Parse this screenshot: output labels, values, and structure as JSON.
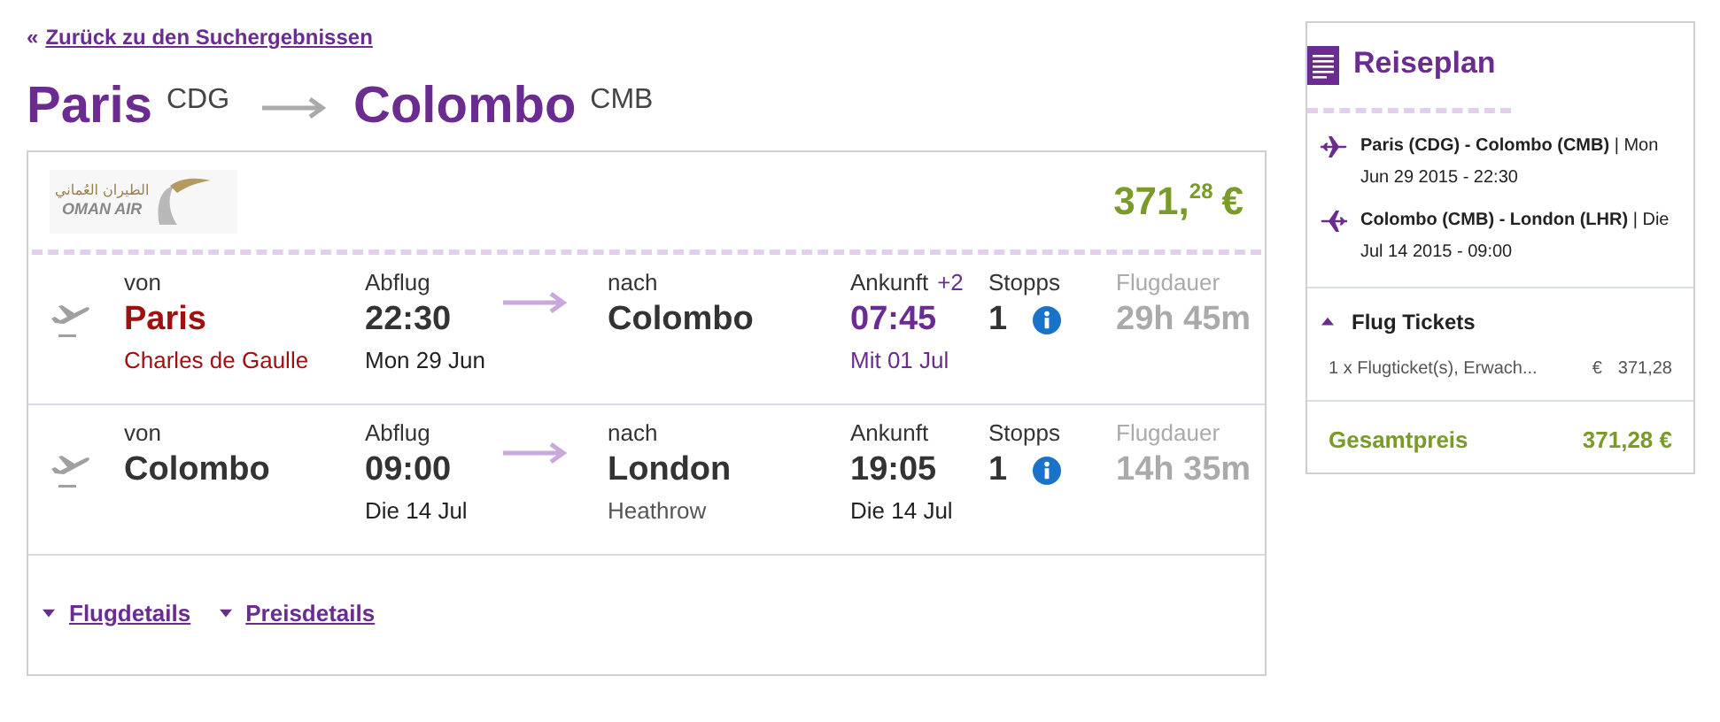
{
  "back_link": {
    "prefix": "«",
    "label": "Zurück zu den Suchergebnissen"
  },
  "route": {
    "from_city": "Paris",
    "from_code": "CDG",
    "to_city": "Colombo",
    "to_code": "CMB"
  },
  "offer": {
    "airline_logo": {
      "arabic": "الطيران العُماني",
      "latin": "OMAN AIR"
    },
    "price_main": "371,",
    "price_cents": "28",
    "currency": "€",
    "legs": [
      {
        "from_label": "von",
        "from_city": "Paris",
        "from_airport": "Charles de Gaulle",
        "from_highlighted": true,
        "dep_label": "Abflug",
        "dep_time": "22:30",
        "dep_date": "Mon 29 Jun",
        "to_label": "nach",
        "to_city": "Colombo",
        "arr_label": "Ankunft",
        "arr_offset": "+2",
        "arr_time": "07:45",
        "arr_date": "Mit 01 Jul",
        "arr_highlighted": true,
        "stops_label": "Stopps",
        "stops": "1",
        "duration_label": "Flugdauer",
        "duration": "29h 45m"
      },
      {
        "from_label": "von",
        "from_city": "Colombo",
        "from_highlighted": false,
        "dep_label": "Abflug",
        "dep_time": "09:00",
        "dep_date": "Die 14 Jul",
        "to_label": "nach",
        "to_city": "London",
        "to_airport": "Heathrow",
        "arr_label": "Ankunft",
        "arr_time": "19:05",
        "arr_date": "Die 14 Jul",
        "arr_highlighted": false,
        "stops_label": "Stopps",
        "stops": "1",
        "duration_label": "Flugdauer",
        "duration": "14h 35m"
      }
    ],
    "detail_links": [
      {
        "label": "Flugdetails",
        "expanded": false
      },
      {
        "label": "Preisdetails",
        "expanded": false
      }
    ]
  },
  "itinerary": {
    "title": "Reiseplan",
    "flights": [
      {
        "kind": "outbound",
        "text": "**Paris (CDG) - Colombo (CMB)** | Mon Jun 29 2015 - 22:30"
      },
      {
        "kind": "return",
        "text": "**Colombo (CMB) - London (LHR)** | Die Jul 14 2015 - 09:00"
      }
    ],
    "tickets": {
      "title": "Flug Tickets",
      "expanded": true,
      "items": [
        {
          "description": "1 x Flugticket(s), Erwach...",
          "currency": "€",
          "amount": "371,28"
        }
      ]
    },
    "total": {
      "label": "Gesamtpreis",
      "value": "371,28 €"
    }
  }
}
